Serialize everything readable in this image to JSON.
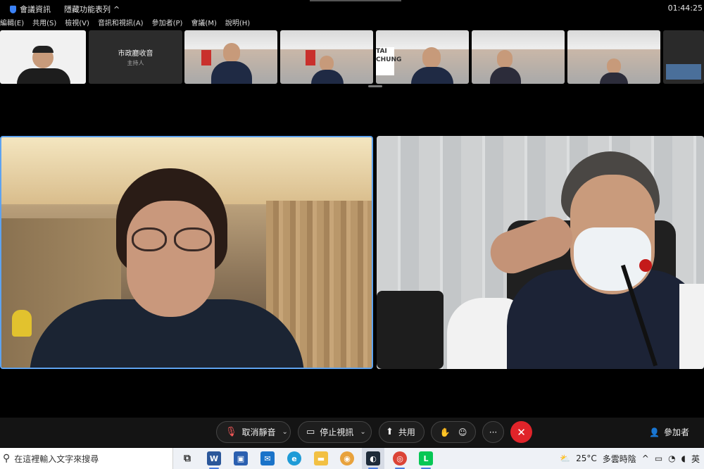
{
  "topbar": {
    "meeting_info": "會議資訊",
    "hide_features": "隱藏功能表列",
    "clock": "01:44:25"
  },
  "menu": [
    "編輯(E)",
    "共用(S)",
    "檢視(V)",
    "音訊和視訊(A)",
    "參加者(P)",
    "會議(M)",
    "說明(H)"
  ],
  "thumbnails": {
    "host_name": "市政廳收音",
    "host_role": "主持人",
    "room_text": "TAI CHUNG"
  },
  "toolbar": {
    "mute_label": "取消靜音",
    "video_label": "停止視訊",
    "share_label": "共用",
    "more_label": "···",
    "leave_label": "✕",
    "participants_label": "參加者"
  },
  "taskbar": {
    "search_placeholder": "在這裡輸入文字來搜尋",
    "temperature": "25°C",
    "weather": "多雲時陰",
    "ime": "英",
    "apps": [
      "task-view",
      "word",
      "store",
      "mail",
      "edge",
      "explorer",
      "chrome-canary",
      "webex",
      "chrome",
      "line"
    ]
  },
  "colors": {
    "active_speaker_border": "#5ea3f0",
    "leave_button": "#e0242a",
    "muted_icon": "#ff5a5a"
  }
}
